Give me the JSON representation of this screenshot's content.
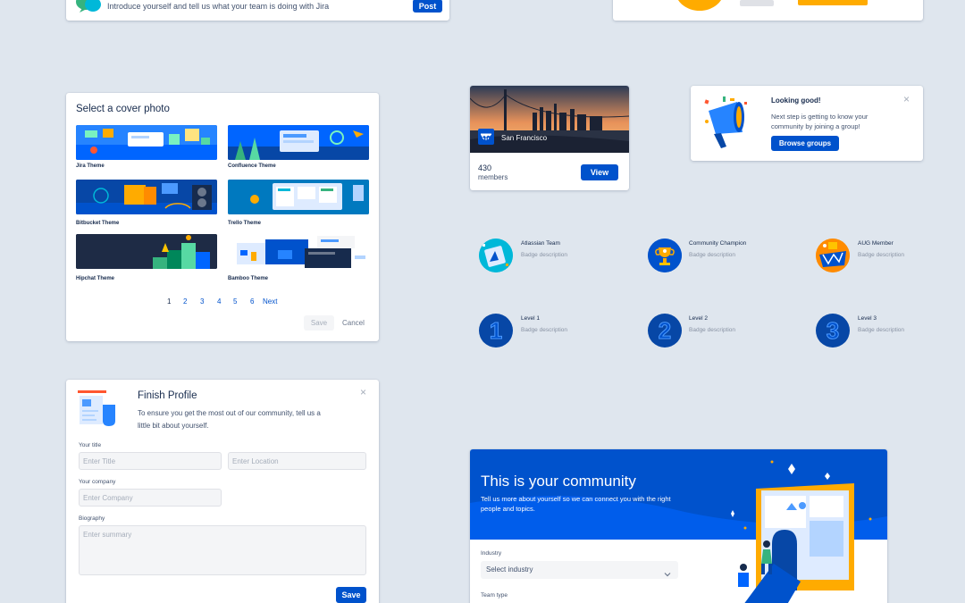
{
  "top_left_card": {
    "text": "Introduce yourself and tell us what your team is doing with Jira",
    "post_label": "Post"
  },
  "cover_photo": {
    "title": "Select a cover photo",
    "themes": [
      {
        "label": "Jira Theme",
        "color": "#2684ff"
      },
      {
        "label": "Confluence Theme",
        "color": "#0065ff"
      },
      {
        "label": "Bitbucket Theme",
        "color": "#0747a6"
      },
      {
        "label": "Trello Theme",
        "color": "#0079bf"
      },
      {
        "label": "Hipchat Theme",
        "color": "#1e2b45"
      },
      {
        "label": "Bamboo Theme",
        "color": "#ffffff"
      }
    ],
    "pagination": [
      "1",
      "2",
      "3",
      "4",
      "5",
      "6"
    ],
    "next_label": "Next",
    "save_label": "Save",
    "cancel_label": "Cancel"
  },
  "group_card": {
    "city": "San Francisco",
    "count": "430",
    "count_label": "members",
    "view_label": "View"
  },
  "looking_good": {
    "title": "Looking good!",
    "body": "Next step is getting to know your community by joining a group!",
    "button_label": "Browse groups",
    "close": "×"
  },
  "badges": [
    {
      "name": "Atlassian Team",
      "desc": "Badge description",
      "icon": "atlassian-team-badge-icon"
    },
    {
      "name": "Community Champion",
      "desc": "Badge description",
      "icon": "trophy-badge-icon"
    },
    {
      "name": "AUG Member",
      "desc": "Badge description",
      "icon": "aug-member-badge-icon"
    },
    {
      "name": "Level 1",
      "desc": "Badge description",
      "numeral": "1"
    },
    {
      "name": "Level 2",
      "desc": "Badge description",
      "numeral": "2"
    },
    {
      "name": "Level 3",
      "desc": "Badge description",
      "numeral": "3"
    }
  ],
  "finish_profile": {
    "title": "Finish Profile",
    "body": "To ensure you get the most out of our community, tell us a little bit about yourself.",
    "close": "×",
    "your_title_label": "Your title",
    "title_placeholder": "Enter Title",
    "location_placeholder": "Enter Location",
    "company_label": "Your company",
    "company_placeholder": "Enter Company",
    "bio_label": "Biography",
    "bio_placeholder": "Enter summary",
    "save_label": "Save"
  },
  "community": {
    "title": "This is your community",
    "subtitle": "Tell us more about yourself so we can connect you with the right people and topics.",
    "industry_label": "Industry",
    "industry_value": "Select industry",
    "team_type_label": "Team type"
  },
  "colors": {
    "primary": "#0052cc",
    "background": "#dfe6ee",
    "accent_yellow": "#ffab00"
  }
}
